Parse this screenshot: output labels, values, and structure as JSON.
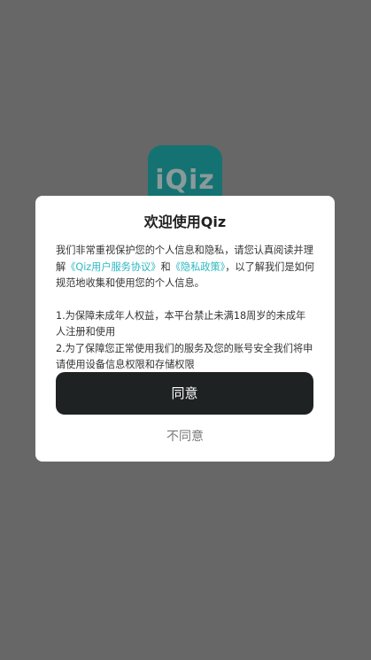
{
  "app": {
    "logo_text": "iQiz"
  },
  "dialog": {
    "title": "欢迎使用Qiz",
    "intro_part1": "我们非常重视保护您的个人信息和隐私，请您认真阅读并理解",
    "user_agreement_link": "《Qiz用户服务协议》",
    "intro_and": "和",
    "privacy_policy_link": "《隐私政策》",
    "intro_part2": "，以了解我们是如何规范地收集和使用您的个人信息。",
    "point1": "1.为保障未成年人权益，本平台禁止未满18周岁的未成年人注册和使用",
    "point2": "2.为了保障您正常使用我们的服务及您的账号安全我们将申请使用设备信息权限和存储权限",
    "agree_label": "同意",
    "disagree_label": "不同意"
  },
  "colors": {
    "backdrop": "#666766",
    "logo_bg": "#157272",
    "link": "#2bb8c1",
    "agree_button_bg": "#1f2223"
  }
}
